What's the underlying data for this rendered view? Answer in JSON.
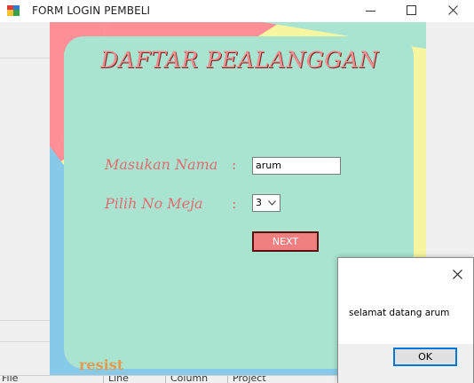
{
  "window": {
    "title": "FORM LOGIN PEMBELI",
    "controls": [
      "minimize-icon",
      "maximize-icon",
      "close-icon"
    ]
  },
  "form": {
    "heading": "DAFTAR PEALANGGAN",
    "fields": {
      "nama": {
        "label": "Masukan Nama",
        "colon": ":",
        "value": "arum"
      },
      "meja": {
        "label": "Pilih No Meja",
        "colon": ":",
        "value": "3"
      }
    },
    "next_label": "NEXT",
    "footer_text": "resist"
  },
  "status_strip": [
    "File",
    "Line",
    "Column",
    "Project"
  ],
  "message_box": {
    "text": "selamat datang arum",
    "ok_label": "OK",
    "close_icon": "close-icon"
  },
  "colors": {
    "panel": "#a8e4cf",
    "pink_corner": "#ff8f97",
    "blue_corner": "#87c9e8",
    "yellow_corner": "#f6f6a0",
    "heading": "#f28c8f",
    "label": "#e56b73",
    "next_button": "#f08080",
    "ok_border": "#0078d7"
  }
}
